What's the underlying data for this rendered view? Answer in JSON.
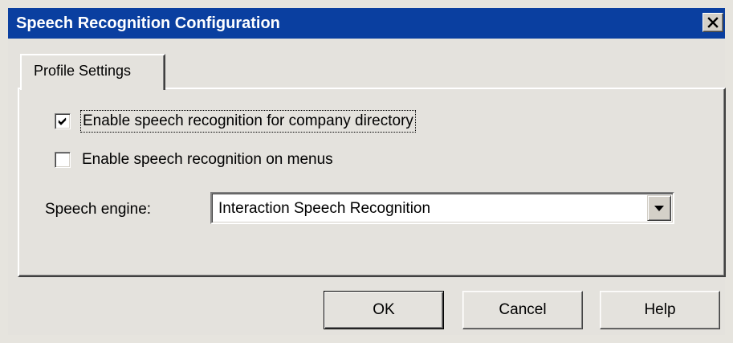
{
  "window": {
    "title": "Speech Recognition Configuration",
    "close_glyph": "✕"
  },
  "tabs": [
    {
      "label": "Profile Settings",
      "selected": true
    }
  ],
  "options": {
    "company_directory": {
      "label": "Enable speech recognition for company directory",
      "checked": true
    },
    "menus": {
      "label": "Enable speech recognition on menus",
      "checked": false
    }
  },
  "speech_engine": {
    "label": "Speech engine:",
    "value": "Interaction Speech Recognition"
  },
  "buttons": {
    "ok": "OK",
    "cancel": "Cancel",
    "help": "Help"
  },
  "colors": {
    "title_bar": "#0a3fa0",
    "title_text": "#ffffff",
    "dialog_face": "#e4e2dd"
  },
  "icons": {
    "close": "close-icon",
    "check": "checkmark-icon",
    "dropdown": "chevron-down-icon"
  }
}
